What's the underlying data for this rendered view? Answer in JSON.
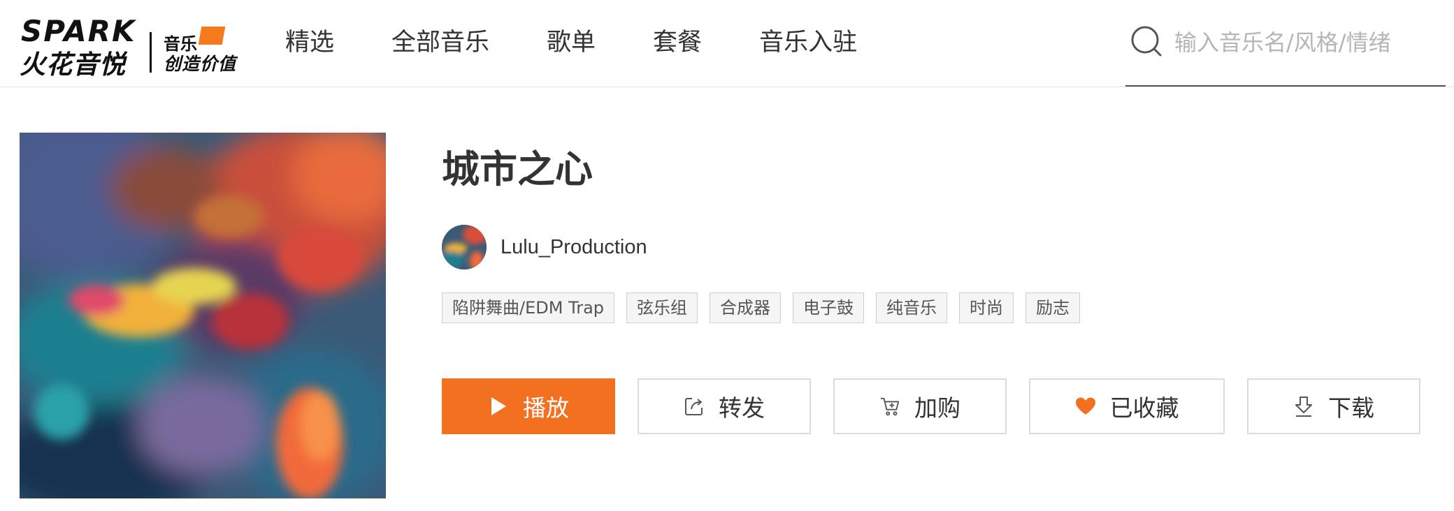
{
  "header": {
    "logo": {
      "brand_en": "SPARK",
      "brand_cn": "火花音悦",
      "slogan_line1": "音乐",
      "slogan_line2": "创造价值",
      "accent_color": "#f47a20"
    },
    "nav": [
      {
        "label": "精选"
      },
      {
        "label": "全部音乐"
      },
      {
        "label": "歌单"
      },
      {
        "label": "套餐"
      },
      {
        "label": "音乐入驻"
      }
    ],
    "search": {
      "placeholder": "输入音乐名/风格/情绪",
      "value": "",
      "icon": "search-icon"
    }
  },
  "song": {
    "title": "城市之心",
    "artist": "Lulu_Production",
    "tags": [
      "陷阱舞曲/EDM Trap",
      "弦乐组",
      "合成器",
      "电子鼓",
      "纯音乐",
      "时尚",
      "励志"
    ]
  },
  "actions": {
    "play": {
      "label": "播放",
      "icon": "play-icon",
      "color": "#f37021"
    },
    "share": {
      "label": "转发",
      "icon": "share-icon"
    },
    "cart": {
      "label": "加购",
      "icon": "cart-icon"
    },
    "favorite": {
      "label": "已收藏",
      "icon": "heart-icon",
      "color": "#f37021"
    },
    "download": {
      "label": "下载",
      "icon": "download-icon"
    }
  }
}
